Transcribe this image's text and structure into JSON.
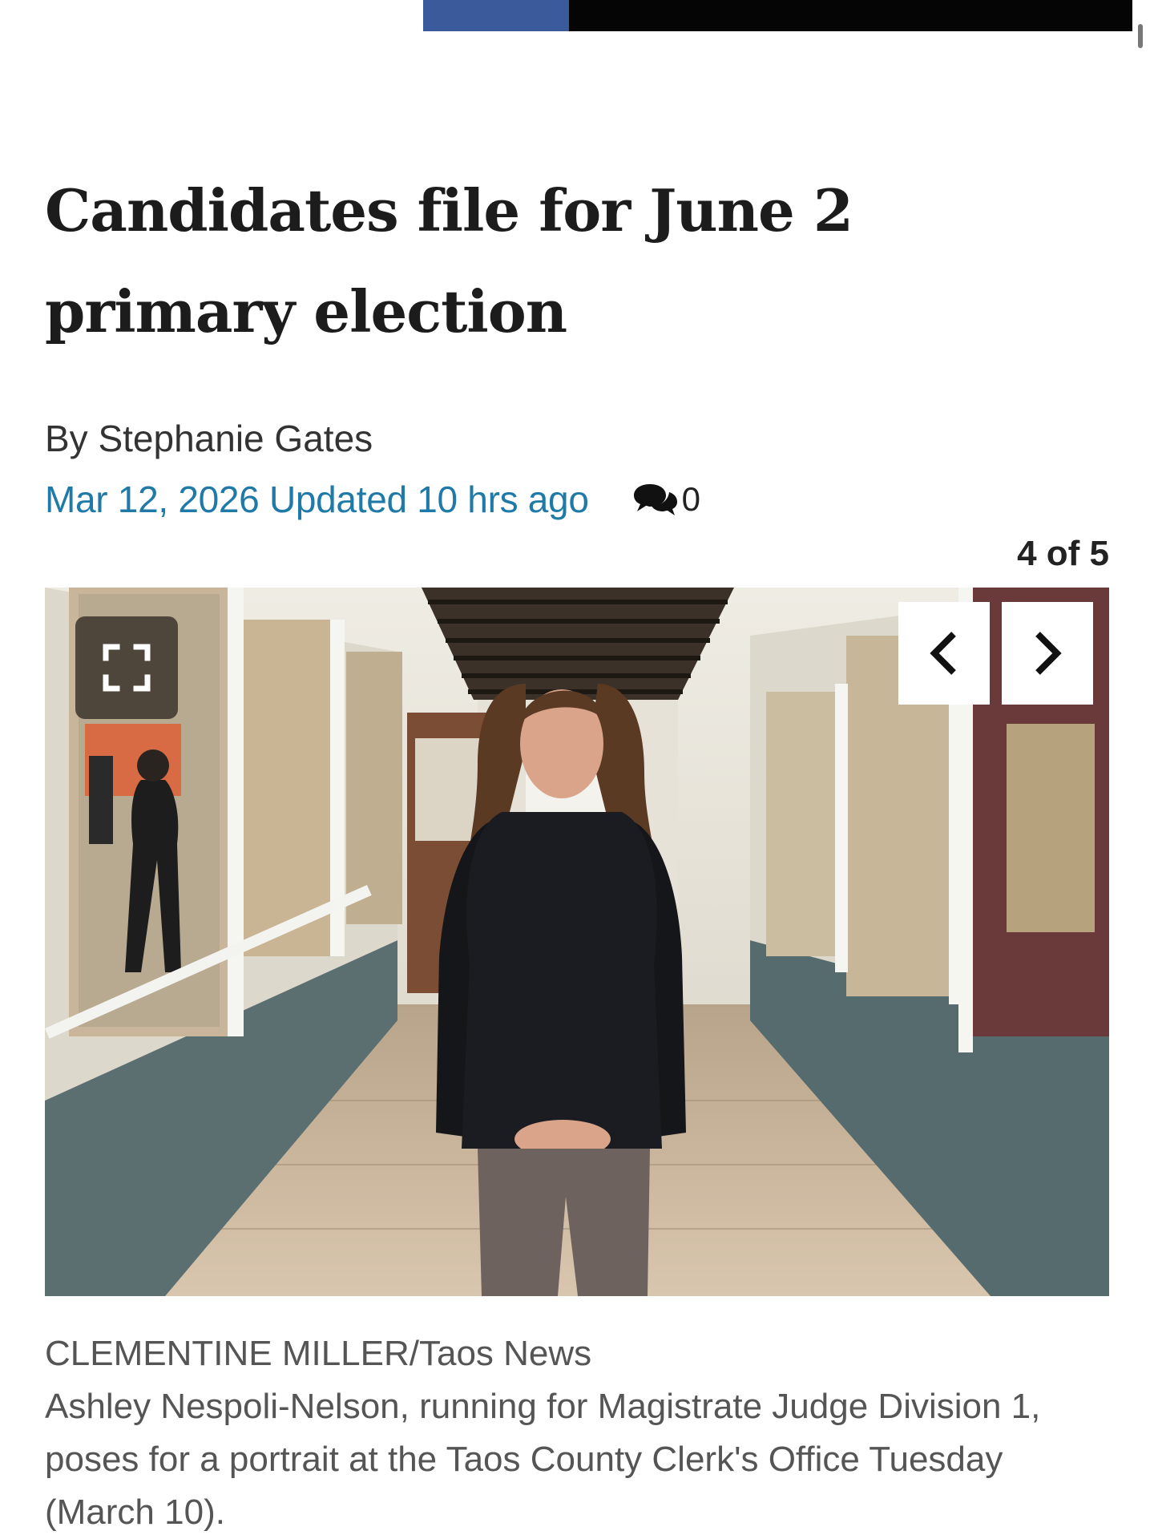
{
  "article": {
    "headline": "Candidates file for June 2 primary election",
    "byline": "By Stephanie Gates",
    "date_line": "Mar 12, 2026 Updated 10 hrs ago",
    "comment_count": "0"
  },
  "gallery": {
    "counter": "4 of 5",
    "fullscreen_icon": "expand-icon",
    "prev_icon": "chevron-left-icon",
    "next_icon": "chevron-right-icon",
    "photo_credit": "CLEMENTINE MILLER/Taos News",
    "caption": "Ashley Nespoli-Nelson, running for Magistrate Judge Division 1, poses for a portrait at the Taos County Clerk's Office Tuesday (March 10)."
  },
  "colors": {
    "date_link": "#1f7aa8",
    "topbar_accent": "#3a5a9c",
    "headline": "#1c1c1c"
  }
}
